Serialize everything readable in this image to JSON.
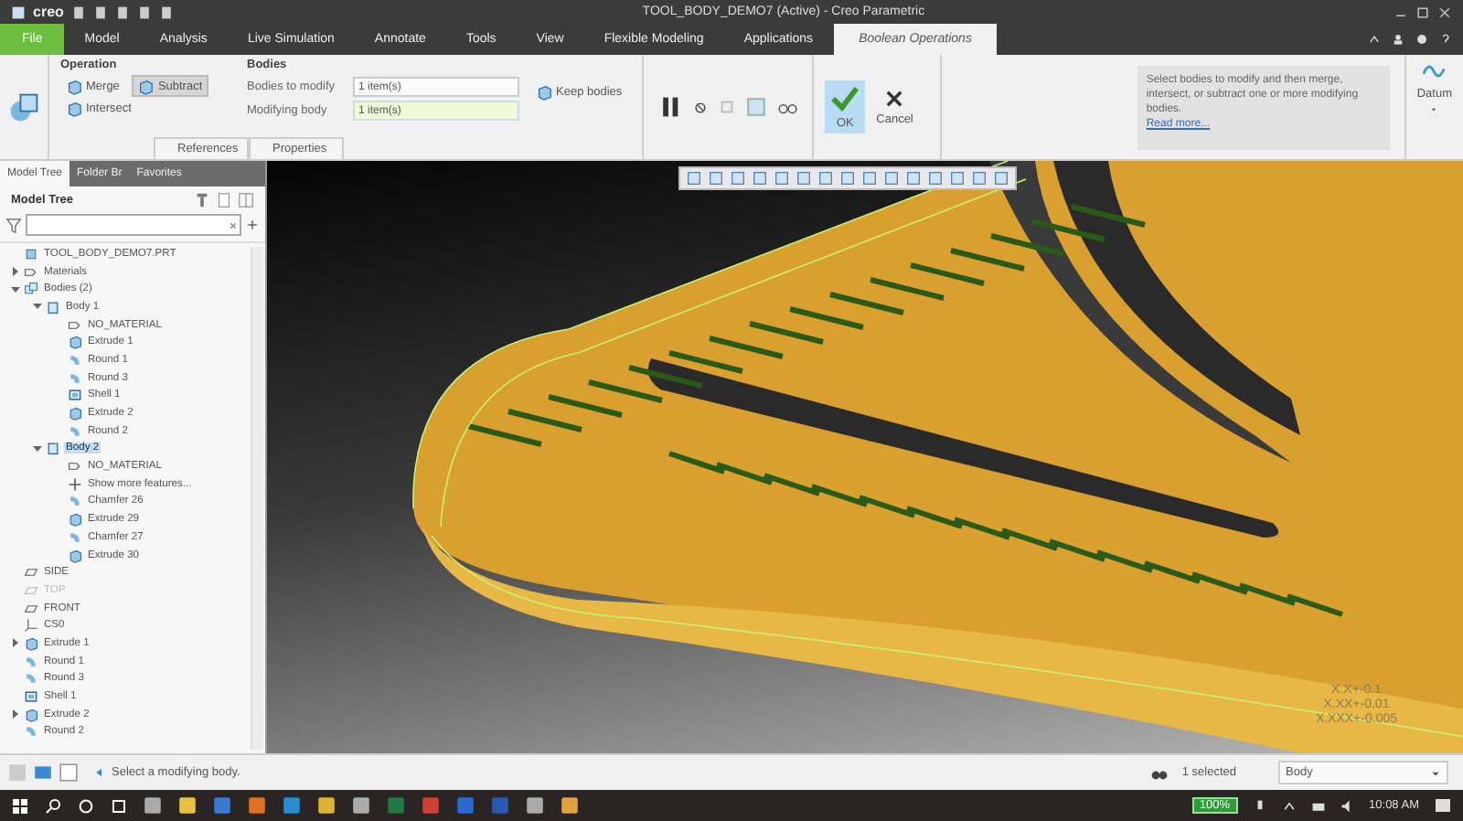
{
  "window": {
    "logo": "creo",
    "title": "TOOL_BODY_DEMO7 (Active) - Creo Parametric"
  },
  "menu_tabs": [
    {
      "label": "File",
      "kind": "file",
      "selected": false
    },
    {
      "label": "Model",
      "kind": "tab",
      "selected": false
    },
    {
      "label": "Analysis",
      "kind": "tab",
      "selected": false
    },
    {
      "label": "Live Simulation",
      "kind": "tab",
      "selected": false
    },
    {
      "label": "Annotate",
      "kind": "tab",
      "selected": false
    },
    {
      "label": "Tools",
      "kind": "tab",
      "selected": false
    },
    {
      "label": "View",
      "kind": "tab",
      "selected": false
    },
    {
      "label": "Flexible Modeling",
      "kind": "tab",
      "selected": false
    },
    {
      "label": "Applications",
      "kind": "tab",
      "selected": false
    },
    {
      "label": "Boolean Operations",
      "kind": "contextual",
      "selected": true
    }
  ],
  "ribbon": {
    "operation": {
      "title": "Operation",
      "options": [
        {
          "label": "Merge",
          "selected": false
        },
        {
          "label": "Subtract",
          "selected": true
        },
        {
          "label": "Intersect",
          "selected": false
        }
      ]
    },
    "bodies": {
      "title": "Bodies",
      "fields": [
        {
          "label": "Bodies to modify",
          "value": "1 item(s)",
          "active": false
        },
        {
          "label": "Modifying body",
          "value": "1 item(s)",
          "active": true
        }
      ],
      "keep_bodies": "Keep bodies"
    },
    "tabs": [
      {
        "label": "References"
      },
      {
        "label": "Properties"
      }
    ],
    "ok": "OK",
    "cancel": "Cancel",
    "help": {
      "text": "Select bodies to modify and then merge, intersect, or subtract one or more modifying bodies.",
      "link": "Read more..."
    },
    "datum": "Datum"
  },
  "side_tabs": [
    {
      "label": "Model Tree",
      "selected": true
    },
    {
      "label": "Folder Br",
      "selected": false
    },
    {
      "label": "Favorites",
      "selected": false
    }
  ],
  "model_tree": {
    "title": "Model Tree",
    "items": [
      {
        "label": "TOOL_BODY_DEMO7.PRT",
        "kind": "part",
        "selected": false,
        "dimmed": false
      },
      {
        "label": "Materials",
        "kind": "materials",
        "selected": false,
        "dimmed": false,
        "expanded": false
      },
      {
        "label": "Bodies (2)",
        "kind": "bodies",
        "selected": false,
        "dimmed": false,
        "expanded": true,
        "children": [
          {
            "label": "Body 1",
            "kind": "body",
            "selected": false,
            "dimmed": false,
            "expanded": true,
            "children": [
              {
                "label": "NO_MATERIAL",
                "kind": "material",
                "selected": false,
                "dimmed": false
              },
              {
                "label": "Extrude 1",
                "kind": "extrude",
                "selected": false,
                "dimmed": false
              },
              {
                "label": "Round 1",
                "kind": "round",
                "selected": false,
                "dimmed": false
              },
              {
                "label": "Round 3",
                "kind": "round",
                "selected": false,
                "dimmed": false
              },
              {
                "label": "Shell 1",
                "kind": "shell",
                "selected": false,
                "dimmed": false
              },
              {
                "label": "Extrude 2",
                "kind": "extrude",
                "selected": false,
                "dimmed": false
              },
              {
                "label": "Round 2",
                "kind": "round",
                "selected": false,
                "dimmed": false
              }
            ]
          },
          {
            "label": "Body 2",
            "kind": "body",
            "selected": true,
            "dimmed": false,
            "expanded": true,
            "children": [
              {
                "label": "NO_MATERIAL",
                "kind": "material",
                "selected": false,
                "dimmed": false
              },
              {
                "label": "Show more features...",
                "kind": "more",
                "selected": false,
                "dimmed": false
              },
              {
                "label": "Chamfer 26",
                "kind": "round",
                "selected": false,
                "dimmed": false
              },
              {
                "label": "Extrude 29",
                "kind": "extrude",
                "selected": false,
                "dimmed": false
              },
              {
                "label": "Chamfer 27",
                "kind": "round",
                "selected": false,
                "dimmed": false
              },
              {
                "label": "Extrude 30",
                "kind": "extrude",
                "selected": false,
                "dimmed": false
              }
            ]
          }
        ]
      },
      {
        "label": "SIDE",
        "kind": "plane",
        "selected": false,
        "dimmed": false
      },
      {
        "label": "TOP",
        "kind": "plane",
        "selected": false,
        "dimmed": true
      },
      {
        "label": "FRONT",
        "kind": "plane",
        "selected": false,
        "dimmed": false
      },
      {
        "label": "CS0",
        "kind": "csys",
        "selected": false,
        "dimmed": false
      },
      {
        "label": "Extrude 1",
        "kind": "extrude",
        "selected": false,
        "dimmed": false,
        "expanded": false
      },
      {
        "label": "Round 1",
        "kind": "round",
        "selected": false,
        "dimmed": false
      },
      {
        "label": "Round 3",
        "kind": "round",
        "selected": false,
        "dimmed": false
      },
      {
        "label": "Shell 1",
        "kind": "shell",
        "selected": false,
        "dimmed": false
      },
      {
        "label": "Extrude 2",
        "kind": "extrude",
        "selected": false,
        "dimmed": false,
        "expanded": false
      },
      {
        "label": "Round 2",
        "kind": "round",
        "selected": false,
        "dimmed": false
      }
    ]
  },
  "viewport": {
    "annotations": [
      "X.X+-0.1",
      "X.XX+-0.01",
      "X.XXX+-0.005"
    ]
  },
  "status_bar": {
    "message": "Select a modifying body.",
    "selection": "1 selected",
    "filter": "Body"
  },
  "taskbar": {
    "battery": "100%",
    "time": "10:08 AM"
  }
}
